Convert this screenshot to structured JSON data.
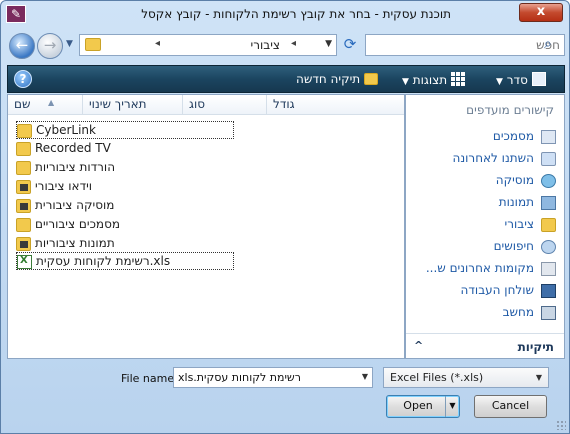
{
  "window": {
    "title": "תוכנת עסקית - בחר את קובץ רשימת הלקוחות - קובץ אקסל",
    "close_label": "x"
  },
  "nav": {
    "back_label": "←",
    "forward_label": "→",
    "address": {
      "crumb": "ציבורי",
      "arrow_left": "▸",
      "arrow_right": "◂"
    },
    "refresh_label": "⟳",
    "search_placeholder": "חפש"
  },
  "toolbar": {
    "help_label": "?",
    "organize_label": "סדר",
    "views_label": "תצוגות",
    "new_folder_label": "תיקיה חדשה"
  },
  "columns": {
    "name": "שם",
    "date": "תאריך שינוי",
    "type": "סוג",
    "size": "גודל"
  },
  "files": [
    {
      "name": "CyberLink",
      "icon": "folder-icon"
    },
    {
      "name": "Recorded TV",
      "icon": "folder-icon"
    },
    {
      "name": "הורדות ציבוריות",
      "icon": "folder-icon"
    },
    {
      "name": "וידאו ציבורי",
      "icon": "video-folder-icon"
    },
    {
      "name": "מוסיקה ציבורית",
      "icon": "music-folder-icon"
    },
    {
      "name": "מסמכים ציבוריים",
      "icon": "folder-icon"
    },
    {
      "name": "תמונות ציבוריות",
      "icon": "pictures-folder-icon"
    },
    {
      "name": "רשימת לקוחות עסקית.xls",
      "icon": "excel-file-icon"
    }
  ],
  "navpane": {
    "header": "קישורים מועדפים",
    "items": [
      {
        "label": "מסמכים",
        "icon": "documents-icon"
      },
      {
        "label": "השתנו לאחרונה",
        "icon": "recently-changed-icon"
      },
      {
        "label": "מוסיקה",
        "icon": "music-icon"
      },
      {
        "label": "תמונות",
        "icon": "pictures-icon"
      },
      {
        "label": "ציבורי",
        "icon": "public-folder-icon"
      },
      {
        "label": "חיפושים",
        "icon": "searches-icon"
      },
      {
        "label": "מקומות אחרונים ש...",
        "icon": "recent-places-icon"
      },
      {
        "label": "שולחן העבודה",
        "icon": "desktop-icon"
      },
      {
        "label": "מחשב",
        "icon": "computer-icon"
      }
    ],
    "folders_label": "תיקיות"
  },
  "bottom": {
    "file_name_label": "File name:",
    "file_name_value": "רשימת לקוחות עסקית.xls",
    "file_type_value": "Excel Files (*.xls)",
    "open_label": "Open",
    "cancel_label": "Cancel"
  }
}
